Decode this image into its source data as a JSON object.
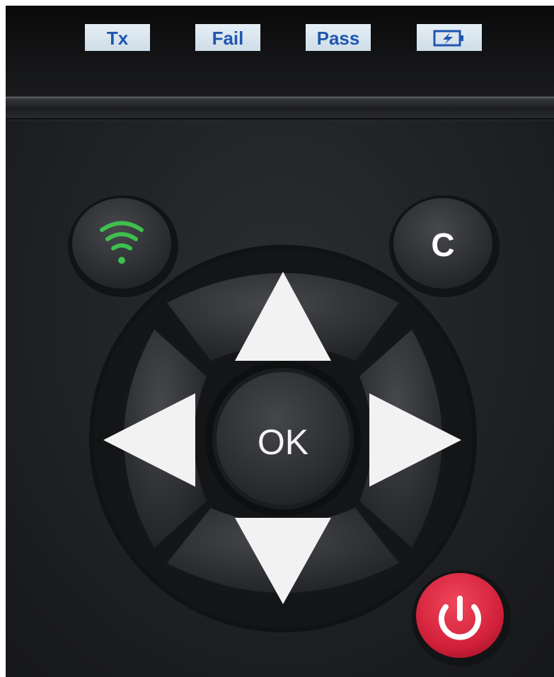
{
  "indicators": [
    {
      "label": "Tx"
    },
    {
      "label": "Fail"
    },
    {
      "label": "Pass"
    },
    {
      "label": "",
      "icon": "battery-charging-icon"
    }
  ],
  "keypad": {
    "wireless_button_icon": "wifi-icon",
    "clear_button_label": "C",
    "ok_button_label": "OK",
    "up_button_icon": "arrow-up-icon",
    "down_button_icon": "arrow-down-icon",
    "left_button_icon": "arrow-left-icon",
    "right_button_icon": "arrow-right-icon",
    "power_button_icon": "power-icon"
  },
  "colors": {
    "indicator_text": "#1f57b0",
    "indicator_window": "#dbe8f1",
    "wifi_icon": "#3fbf4e",
    "power_button": "#d7263b",
    "body": "#202225"
  }
}
